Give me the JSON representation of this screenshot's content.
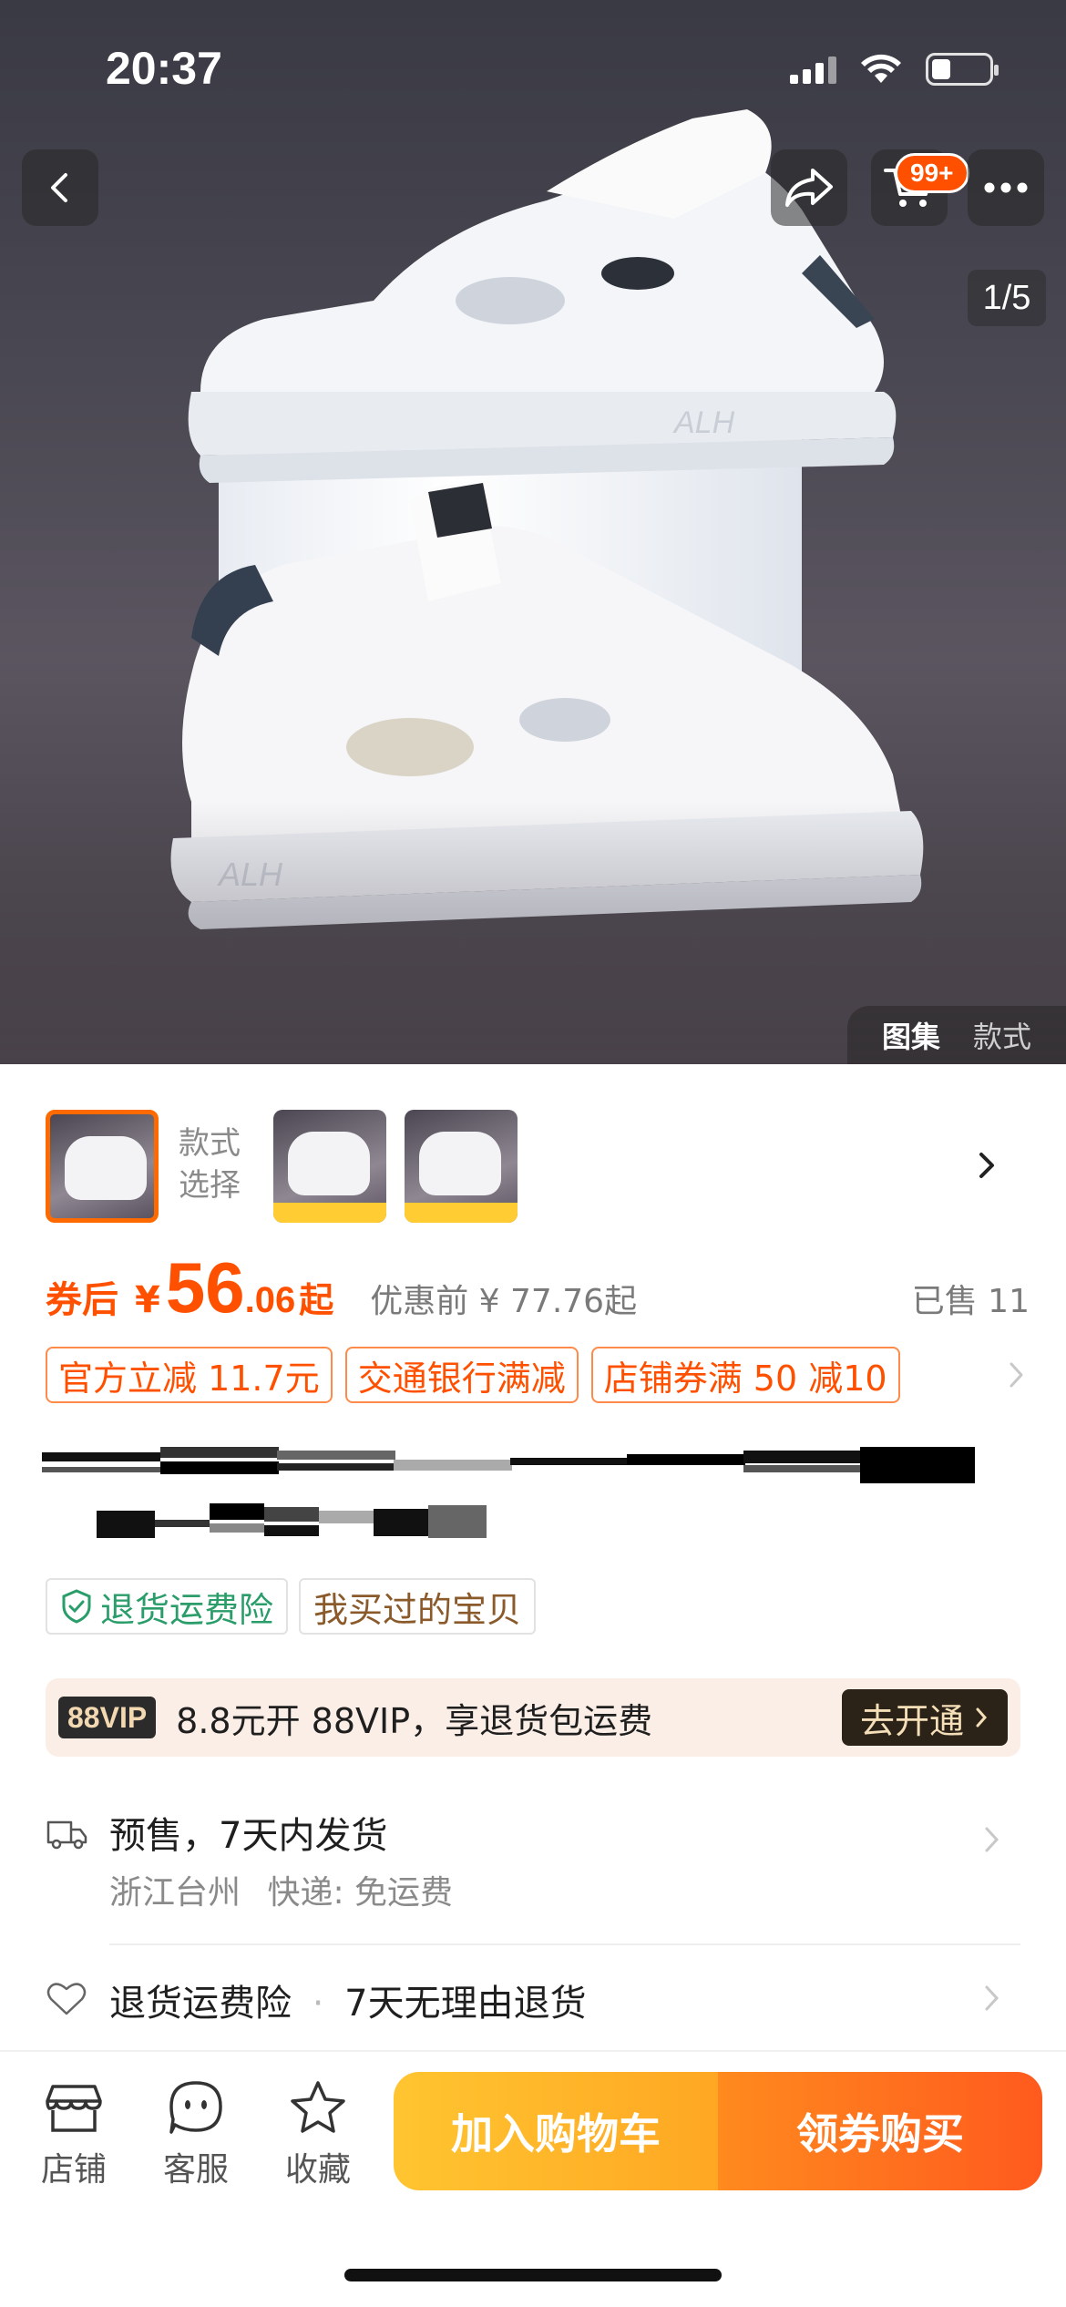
{
  "status_bar": {
    "time": "20:37"
  },
  "header": {
    "cart_badge": "99+",
    "page_indicator": "1/5",
    "gallery_tabs": [
      "图集",
      "款式"
    ]
  },
  "style_selector": {
    "label": "款式选择"
  },
  "price": {
    "after_coupon_label": "券后",
    "currency": "¥",
    "integer": "56",
    "decimal": ".06",
    "from_suffix": "起",
    "original_label": "优惠前 ¥ 77.76起",
    "sold": "已售 11"
  },
  "promotions": [
    "官方立减 11.7元",
    "交通银行满减",
    "店铺券满 50 减10"
  ],
  "service_tags": [
    "退货运费险",
    "我买过的宝贝"
  ],
  "vip": {
    "logo": "88VIP",
    "text": "8.8元开 88VIP，享退货包运费",
    "button": "去开通"
  },
  "shipping": {
    "title": "预售，7天内发货",
    "origin": "浙江台州",
    "delivery": "快递: 免运费"
  },
  "returns": {
    "insurance": "退货运费险",
    "policy": "7天无理由退货"
  },
  "bottom_bar": {
    "shop": "店铺",
    "service": "客服",
    "favorite": "收藏",
    "add_to_cart": "加入购物车",
    "buy": "领券购买"
  },
  "colors": {
    "accent": "#ff5000",
    "vip_bg": "#fbeee6",
    "cta_cart": "#ffb52a",
    "cta_buy": "#ff6a1e"
  }
}
